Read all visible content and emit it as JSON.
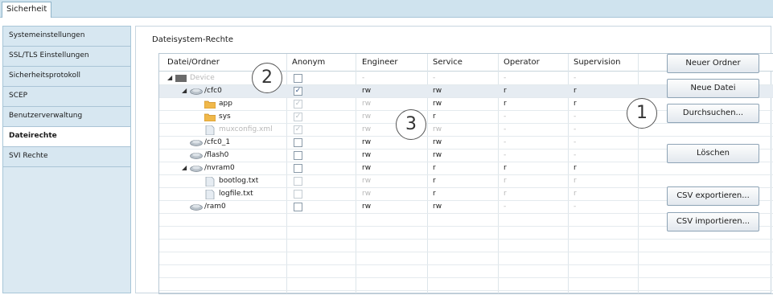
{
  "top_tab": "Sicherheit",
  "sidebar": {
    "items": [
      {
        "label": "Systemeinstellungen",
        "active": false
      },
      {
        "label": "SSL/TLS Einstellungen",
        "active": false
      },
      {
        "label": "Sicherheitsprotokoll",
        "active": false
      },
      {
        "label": "SCEP",
        "active": false
      },
      {
        "label": "Benutzerverwaltung",
        "active": false
      },
      {
        "label": "Dateirechte",
        "active": true
      },
      {
        "label": "SVI Rechte",
        "active": false
      }
    ]
  },
  "panel": {
    "title": "Dateisystem-Rechte"
  },
  "table": {
    "headers": [
      "Datei/Ordner",
      "Anonym",
      "Engineer",
      "Service",
      "Operator",
      "Supervision"
    ],
    "rows": [
      {
        "name": "Device",
        "indent": 0,
        "twisty": "◢",
        "icon": "device-icon",
        "dim": true,
        "anon": "",
        "anon_dim": false,
        "engineer": "-",
        "service": "-",
        "operator": "-",
        "supervision": "-",
        "selected": false
      },
      {
        "name": "/cfc0",
        "indent": 1,
        "twisty": "◢",
        "icon": "drive-icon",
        "dim": false,
        "anon": "✓",
        "anon_dim": false,
        "engineer": "rw",
        "service": "rw",
        "operator": "r",
        "supervision": "r",
        "selected": true
      },
      {
        "name": "app",
        "indent": 2,
        "twisty": "",
        "icon": "folder-icon",
        "dim": false,
        "anon": "✓",
        "anon_dim": true,
        "engineer": "rw",
        "service": "rw",
        "operator": "r",
        "supervision": "r",
        "selected": false
      },
      {
        "name": "sys",
        "indent": 2,
        "twisty": "",
        "icon": "folder-icon",
        "dim": false,
        "anon": "✓",
        "anon_dim": true,
        "engineer": "rw",
        "service": "r",
        "operator": "-",
        "supervision": "-",
        "selected": false
      },
      {
        "name": "muxconfig.xml",
        "indent": 2,
        "twisty": "",
        "icon": "file-icon",
        "dim": true,
        "anon": "✓",
        "anon_dim": true,
        "engineer": "rw",
        "service": "rw",
        "operator": "-",
        "supervision": "-",
        "selected": false
      },
      {
        "name": "/cfc0_1",
        "indent": 1,
        "twisty": "",
        "icon": "drive-icon",
        "dim": false,
        "anon": "",
        "anon_dim": false,
        "engineer": "rw",
        "service": "rw",
        "operator": "-",
        "supervision": "-",
        "selected": false
      },
      {
        "name": "/flash0",
        "indent": 1,
        "twisty": "",
        "icon": "drive-icon",
        "dim": false,
        "anon": "",
        "anon_dim": false,
        "engineer": "rw",
        "service": "rw",
        "operator": "-",
        "supervision": "-",
        "selected": false
      },
      {
        "name": "/nvram0",
        "indent": 1,
        "twisty": "◢",
        "icon": "drive-icon",
        "dim": false,
        "anon": "",
        "anon_dim": false,
        "engineer": "rw",
        "service": "r",
        "operator": "r",
        "supervision": "r",
        "selected": false
      },
      {
        "name": "bootlog.txt",
        "indent": 2,
        "twisty": "",
        "icon": "file-icon",
        "dim": false,
        "anon": "",
        "anon_dim": true,
        "engineer": "rw",
        "service": "r",
        "operator": "r",
        "supervision": "r",
        "selected": false
      },
      {
        "name": "logfile.txt",
        "indent": 2,
        "twisty": "",
        "icon": "file-icon",
        "dim": false,
        "anon": "",
        "anon_dim": true,
        "engineer": "rw",
        "service": "r",
        "operator": "r",
        "supervision": "r",
        "selected": false
      },
      {
        "name": "/ram0",
        "indent": 1,
        "twisty": "",
        "icon": "drive-icon",
        "dim": false,
        "anon": "",
        "anon_dim": false,
        "engineer": "rw",
        "service": "rw",
        "operator": "-",
        "supervision": "-",
        "selected": false
      }
    ],
    "dim_engineer_rows": [
      2,
      3,
      4,
      8,
      9
    ],
    "dim_service_rows": [
      4
    ]
  },
  "buttons": {
    "new_folder": "Neuer Ordner",
    "new_file": "Neue Datei",
    "browse": "Durchsuchen...",
    "delete": "Löschen",
    "csv_export": "CSV exportieren...",
    "csv_import": "CSV importieren..."
  },
  "callouts": [
    "1",
    "2",
    "3"
  ]
}
